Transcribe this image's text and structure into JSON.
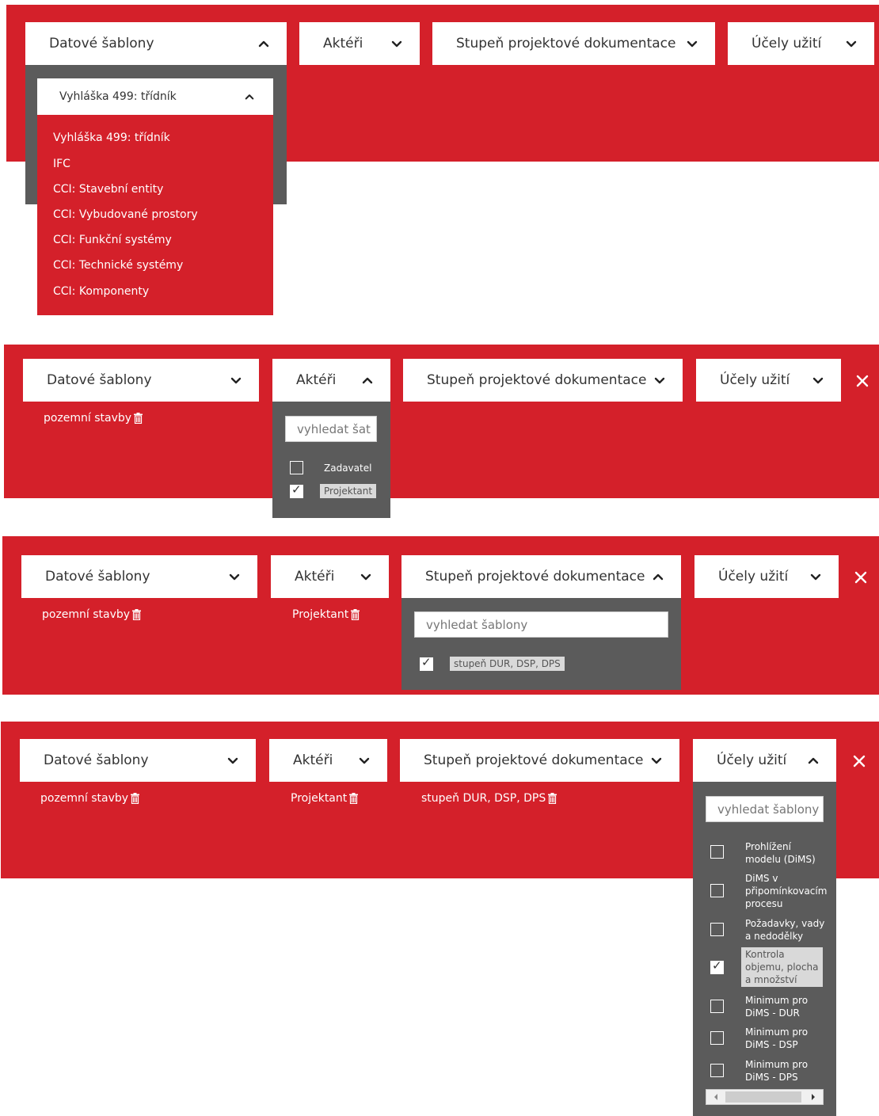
{
  "colors": {
    "accent": "#d4202a",
    "dropdown_bg": "#5b5b5b",
    "white": "#ffffff"
  },
  "icons": {
    "chevron_up": "chevron-up-icon",
    "chevron_down": "chevron-down-icon",
    "close": "close-icon",
    "trash": "trash-icon",
    "check": "checkmark-icon"
  },
  "filters": {
    "datove_sablony": "Datové šablony",
    "akteri": "Aktéři",
    "stupen": "Stupeň projektové dokumentace",
    "ucely": "Účely užití"
  },
  "panel1": {
    "select_value": "Vyhláška 499: třídník",
    "options": [
      "Vyhláška 499: třídník",
      "IFC",
      "CCI: Stavební entity",
      "CCI: Vybudované prostory",
      "CCI: Funkční systémy",
      "CCI: Technické systémy",
      "CCI: Komponenty"
    ]
  },
  "panel2": {
    "chip1": "pozemní stavby",
    "search_value": "vyhledat šat",
    "actors": [
      {
        "label": "Zadavatel",
        "checked": false
      },
      {
        "label": "Projektant",
        "checked": true
      }
    ]
  },
  "panel3": {
    "chip1": "pozemní stavby",
    "chip2": "Projektant",
    "search_placeholder": "vyhledat šablony",
    "option": "stupeň DUR, DSP, DPS"
  },
  "panel4": {
    "chip1": "pozemní stavby",
    "chip2": "Projektant",
    "chip3": "stupeň DUR, DSP, DPS",
    "search_placeholder": "vyhledat šablony",
    "options": [
      {
        "lines": [
          "Prohlížení",
          "modelu (DiMS)"
        ],
        "checked": false
      },
      {
        "lines": [
          "DiMS v",
          "připomínkovacím",
          "procesu"
        ],
        "checked": false
      },
      {
        "lines": [
          "Požadavky, vady",
          "a nedodělky"
        ],
        "checked": false
      },
      {
        "lines": [
          "Kontrola",
          "objemu, plocha",
          "a množství"
        ],
        "checked": true
      },
      {
        "lines": [
          "Minimum pro",
          "DiMS - DUR"
        ],
        "checked": false
      },
      {
        "lines": [
          "Minimum pro",
          "DiMS - DSP"
        ],
        "checked": false
      },
      {
        "lines": [
          "Minimum pro",
          "DiMS - DPS"
        ],
        "checked": false
      }
    ]
  }
}
